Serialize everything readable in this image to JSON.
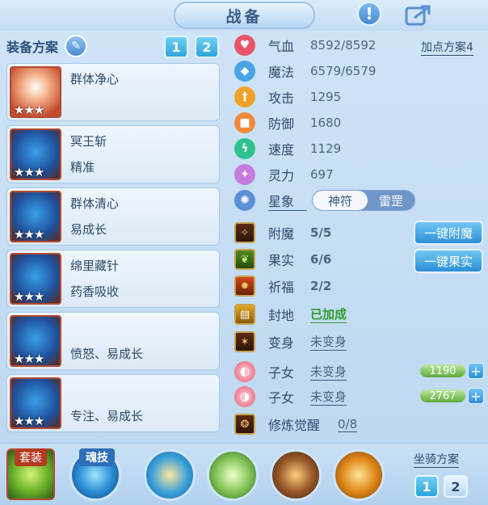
{
  "header": {
    "title": "战备",
    "alert_icon": "exclamation-icon",
    "share_icon": "share-icon"
  },
  "equip_plan": {
    "label": "装备方案",
    "edit_icon": "pencil-icon",
    "buttons": [
      "1",
      "2"
    ],
    "items": [
      {
        "line1": "群体净心",
        "line2": "",
        "stars": "★★★"
      },
      {
        "line1": "冥王斩",
        "line2": "精准",
        "stars": "★★★"
      },
      {
        "line1": "群体清心",
        "line2": "易成长",
        "stars": "★★★"
      },
      {
        "line1": "绵里藏针",
        "line2": "药香吸收",
        "stars": "★★★"
      },
      {
        "line1": "",
        "line2": "愤怒、易成长",
        "stars": "★★★"
      },
      {
        "line1": "",
        "line2": "专注、易成长",
        "stars": "★★★"
      }
    ]
  },
  "stats": {
    "plan_link": "加点方案4",
    "rows": [
      {
        "name": "气血",
        "value": "8592/8592",
        "icon": "heart-icon",
        "color": "#e8556b"
      },
      {
        "name": "魔法",
        "value": "6579/6579",
        "icon": "diamond-icon",
        "color": "#4aa3e8"
      },
      {
        "name": "攻击",
        "value": "1295",
        "icon": "sword-icon",
        "color": "#f0a12a"
      },
      {
        "name": "防御",
        "value": "1680",
        "icon": "shield-icon",
        "color": "#f08a3a"
      },
      {
        "name": "速度",
        "value": "1129",
        "icon": "bolt-icon",
        "color": "#2fc28f"
      },
      {
        "name": "灵力",
        "value": "697",
        "icon": "sparkle-icon",
        "color": "#c77be0"
      }
    ],
    "star_sign": {
      "name": "星象",
      "options": [
        "神符",
        "雷罡"
      ]
    },
    "extras": [
      {
        "name": "附魔",
        "value": "5/5",
        "icon": "enchant-icon"
      },
      {
        "name": "果实",
        "value": "6/6",
        "icon": "fruit-icon"
      },
      {
        "name": "祈福",
        "value": "2/2",
        "icon": "blessing-icon"
      },
      {
        "name": "封地",
        "value": "已加成",
        "icon": "fief-icon"
      },
      {
        "name": "变身",
        "value": "未变身",
        "icon": "transform-icon"
      },
      {
        "name": "子女",
        "value": "未变身",
        "icon": "child-icon"
      },
      {
        "name": "子女",
        "value": "未变身",
        "icon": "child2-icon"
      },
      {
        "name": "修炼觉醒",
        "value": "0/8",
        "icon": "cultivation-icon"
      }
    ],
    "one_click_enchant": "一键附魔",
    "one_click_fruit": "一键果实",
    "child_values": [
      "1190",
      "2767"
    ],
    "plus": "+"
  },
  "bottom": {
    "suit_label": "套装",
    "soul_label": "魂技",
    "mount_label": "坐骑方案",
    "mount_buttons": [
      "1",
      "2"
    ]
  }
}
